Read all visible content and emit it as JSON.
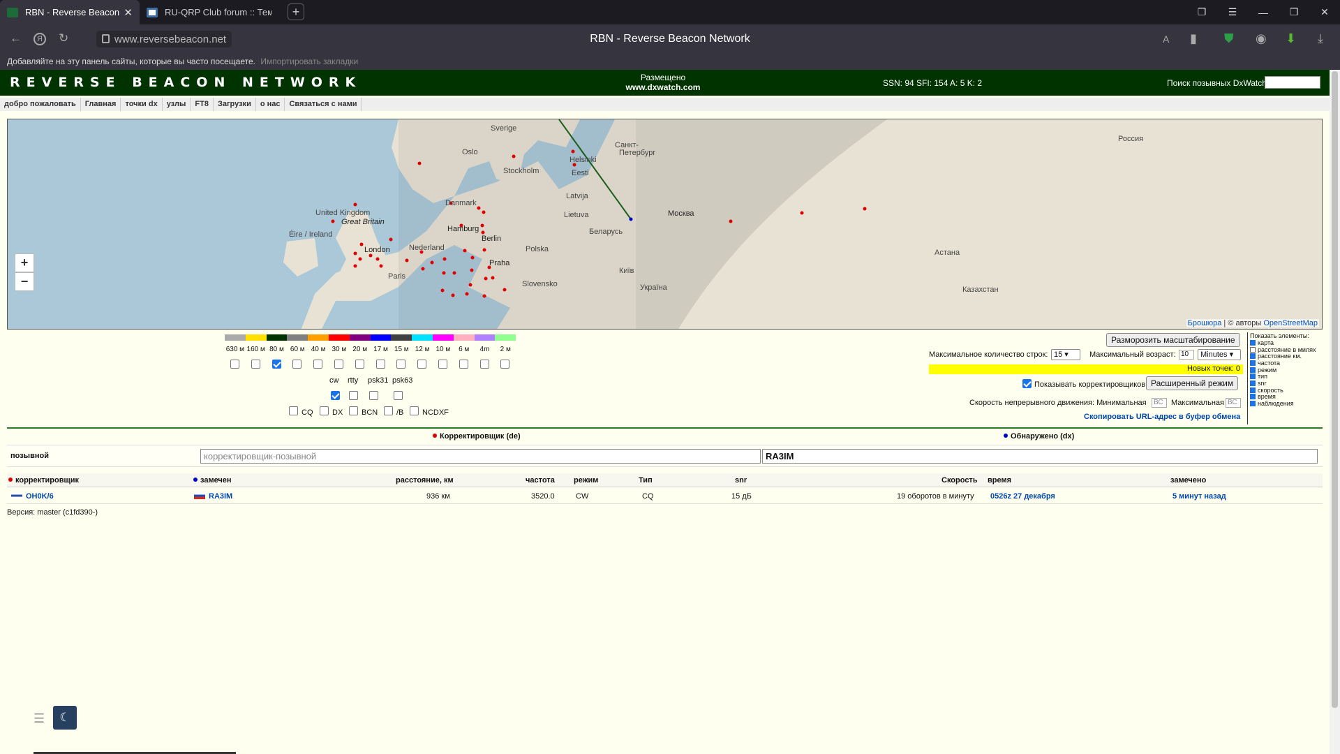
{
  "browser": {
    "tabs": [
      {
        "title": "RBN - Reverse Beacon N",
        "active": true
      },
      {
        "title": "RU-QRP Club forum :: Тема",
        "active": false
      }
    ],
    "new_tab": "+",
    "url": "www.reversebeacon.net",
    "page_title": "RBN - Reverse Beacon Network",
    "bookmarks_text": "Добавляйте на эту панель сайты, которые вы часто посещаете.",
    "bookmarks_import": "Импортировать закладки"
  },
  "site": {
    "logo": "REVERSE BEACON NETWORK",
    "hosted_line1": "Размещено",
    "hosted_line2": "www.dxwatch.com",
    "solar": "SSN: 94 SFI: 154 A: 5 K: 2",
    "dx_search_label": "Поиск позывных DxWatch:",
    "menu": [
      "добро пожаловать",
      "Главная",
      "точки dx",
      "узлы",
      "FT8",
      "Загрузки",
      "о нас",
      "Связаться с нами"
    ]
  },
  "map": {
    "labels": [
      {
        "text": "Sverige"
      },
      {
        "text": "Oslo"
      },
      {
        "text": "Stockholm"
      },
      {
        "text": "Helsinki"
      },
      {
        "text": "Санкт-"
      },
      {
        "text": "Петербург"
      },
      {
        "text": "Eesti"
      },
      {
        "text": "Latvija"
      },
      {
        "text": "Danmark"
      },
      {
        "text": "Lietuva"
      },
      {
        "text": "United Kingdom"
      },
      {
        "text": "Great Britain"
      },
      {
        "text": "Éire / Ireland"
      },
      {
        "text": "Hamburg"
      },
      {
        "text": "Berlin"
      },
      {
        "text": "Беларусь"
      },
      {
        "text": "Nederland"
      },
      {
        "text": "London"
      },
      {
        "text": "Polska"
      },
      {
        "text": "Москва"
      },
      {
        "text": "Praha"
      },
      {
        "text": "Київ"
      },
      {
        "text": "Paris"
      },
      {
        "text": "Slovensko"
      },
      {
        "text": "Україна"
      },
      {
        "text": "Россия"
      },
      {
        "text": "Астана"
      },
      {
        "text": "Казахстан"
      }
    ],
    "zoom_in": "+",
    "zoom_out": "−",
    "attribution_link": "Брошюра",
    "attribution_sep": " | © авторы ",
    "attribution_osm": "OpenStreetMap"
  },
  "bands": [
    {
      "label": "630 м",
      "color": "#aaaaaa",
      "checked": false
    },
    {
      "label": "160 м",
      "color": "#ffe000",
      "checked": false
    },
    {
      "label": "80 м",
      "color": "#003300",
      "checked": true
    },
    {
      "label": "60 м",
      "color": "#808080",
      "checked": false
    },
    {
      "label": "40 м",
      "color": "#ffa000",
      "checked": false
    },
    {
      "label": "30 м",
      "color": "#ff0000",
      "checked": false
    },
    {
      "label": "20 м",
      "color": "#800080",
      "checked": false
    },
    {
      "label": "17 м",
      "color": "#0000ff",
      "checked": false
    },
    {
      "label": "15 м",
      "color": "#404040",
      "checked": false
    },
    {
      "label": "12 м",
      "color": "#00e0ff",
      "checked": false
    },
    {
      "label": "10 м",
      "color": "#ff00ff",
      "checked": false
    },
    {
      "label": "6 м",
      "color": "#ffb0c0",
      "checked": false
    },
    {
      "label": "4m",
      "color": "#b080ff",
      "checked": false
    },
    {
      "label": "2 м",
      "color": "#90ff90",
      "checked": false
    }
  ],
  "modes": [
    {
      "label": "cw",
      "checked": true
    },
    {
      "label": "rtty",
      "checked": false
    },
    {
      "label": "psk31",
      "checked": false
    },
    {
      "label": "psk63",
      "checked": false
    }
  ],
  "types": [
    {
      "label": "CQ",
      "checked": false
    },
    {
      "label": "DX",
      "checked": false
    },
    {
      "label": "BCN",
      "checked": false
    },
    {
      "label": "/B",
      "checked": false
    },
    {
      "label": "NCDXF",
      "checked": false
    }
  ],
  "controls": {
    "unfreeze_zoom": "Разморозить масштабирование",
    "max_rows_label": "Максимальное количество строк:",
    "max_rows_value": "15",
    "max_age_label": "Максимальный возраст:",
    "max_age_value": "10",
    "max_age_unit": "Minutes",
    "new_points": "Новых точек: 0",
    "show_skimmers_label": "Показывать корректировщиков",
    "show_skimmers_checked": true,
    "advanced_mode": "Расширенный режим",
    "speed_label": "Скорость непрерывного движения: Минимальная",
    "speed_min_placeholder": "ВС",
    "speed_max_label": "Максимальная",
    "speed_max_placeholder": "ВС",
    "copy_url": "Скопировать URL-адрес в буфер обмена"
  },
  "show_elements": {
    "title": "Показать элементы:",
    "items": [
      {
        "label": "карта",
        "checked": true
      },
      {
        "label": "расстояние в милях",
        "checked": false
      },
      {
        "label": "расстояние км.",
        "checked": true
      },
      {
        "label": "частота",
        "checked": true
      },
      {
        "label": "режим",
        "checked": true
      },
      {
        "label": "тип",
        "checked": true
      },
      {
        "label": "snr",
        "checked": true
      },
      {
        "label": "скорость",
        "checked": true
      },
      {
        "label": "время",
        "checked": true
      },
      {
        "label": "наблюдения",
        "checked": true
      }
    ]
  },
  "spots": {
    "de_header": "Корректировщик (de)",
    "dx_header": "Обнаружено (dx)",
    "callsign_label": "позывной",
    "de_placeholder": "корректировщик-позывной",
    "dx_value": "RA3IM",
    "columns": {
      "skimmer": "корректировщик",
      "spotted": "замечен",
      "distance": "расстояние, км",
      "freq": "частота",
      "mode": "режим",
      "type": "Тип",
      "snr": "snr",
      "speed": "Скорость",
      "time": "время",
      "seen": "замечено"
    },
    "rows": [
      {
        "skimmer": "OH0K/6",
        "spotted": "RA3IM",
        "distance": "936 км",
        "freq": "3520.0",
        "mode": "CW",
        "type": "CQ",
        "snr": "15 дБ",
        "speed": "19 оборотов в минуту",
        "time": "0526z 27 декабря",
        "seen": "5 минут назад"
      }
    ]
  },
  "version": "Версия: master (c1fd390-)",
  "colors": {
    "header_bg": "#003300",
    "de_dot": "#dd0000",
    "dx_dot": "#0000cc",
    "link": "#0048a8",
    "new_points_bg": "#ffff00"
  }
}
